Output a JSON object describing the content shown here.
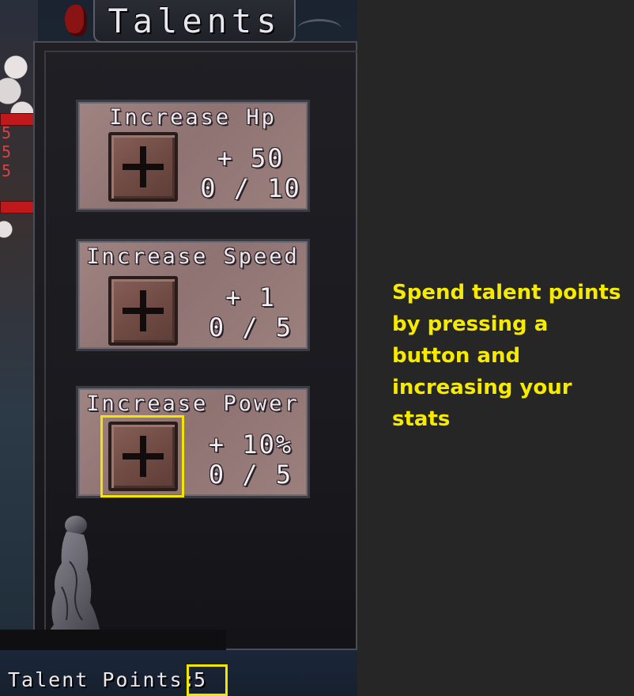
{
  "window": {
    "title": "Talents"
  },
  "talents": [
    {
      "name": "Increase Hp",
      "bonus": "+ 50",
      "progress": "0 / 10",
      "current": 0,
      "max": 10
    },
    {
      "name": "Increase Speed",
      "bonus": "+ 1",
      "progress": "0 / 5",
      "current": 0,
      "max": 5
    },
    {
      "name": "Increase Power",
      "bonus": "+ 10%",
      "progress": "0 / 5",
      "current": 0,
      "max": 5
    }
  ],
  "footer": {
    "label": "Talent Points:",
    "value": "5"
  },
  "tutorial": {
    "text": "Spend talent points by pressing a button and increasing your stats"
  },
  "background": {
    "damage_numbers": [
      "5",
      "5",
      "5"
    ]
  },
  "colors": {
    "highlight": "#f2e600",
    "tutorial_text": "#f6ea00",
    "card": "#98807e",
    "panel": "#1c1c21"
  },
  "icons": {
    "plus_button": "plus-icon",
    "statue": "statue-icon"
  }
}
